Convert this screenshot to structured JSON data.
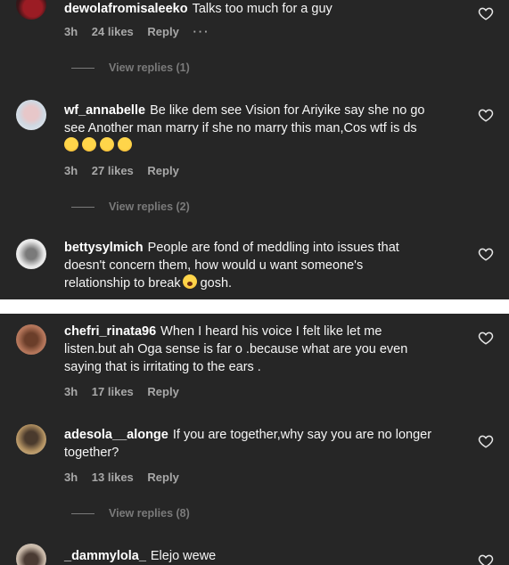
{
  "comments_top": [
    {
      "username": "dewolafromisaleeko",
      "text": "Talks too much for a guy",
      "time": "3h",
      "likes": "24 likes",
      "reply": "Reply",
      "more": "···",
      "view_replies": "View replies (1)"
    },
    {
      "username": "wf_annabelle",
      "text_line1": "Be like dem see Vision for Ariyike say she no go",
      "text_line2": "see Another man marry if she no marry this man,Cos wtf is ds",
      "emojis": [
        "laughing-emoji",
        "laughing-emoji",
        "laughing-emoji",
        "laughing-emoji"
      ],
      "time": "3h",
      "likes": "27 likes",
      "reply": "Reply",
      "view_replies": "View replies (2)"
    },
    {
      "username": "bettysylmich",
      "text_line1": "People are fond of meddling into issues that",
      "text_line2": "doesn't concern them, how would u want someone's",
      "text_line3a": "relationship to break",
      "text_line3b": "gosh."
    }
  ],
  "comments_bottom": [
    {
      "username": "chefri_rinata96",
      "text_line1": "When I heard his voice I felt like let me",
      "text_line2": "listen.but ah Oga sense is far o .because what are you even",
      "text_line3": "saying that is irritating to the ears .",
      "time": "3h",
      "likes": "17 likes",
      "reply": "Reply"
    },
    {
      "username": "adesola__alonge",
      "text_line1": "If you are together,why say you are no longer",
      "text_line2": "together?",
      "time": "3h",
      "likes": "13 likes",
      "reply": "Reply",
      "view_replies": "View replies (8)"
    },
    {
      "username": "_dammylola_",
      "text": "Elejo wewe"
    }
  ],
  "colors": {
    "background": "#262626",
    "text": "#f5f5f5",
    "meta": "#a8a8a8",
    "separator": "#ffffff"
  },
  "icons": {
    "like": "heart-outline-icon"
  }
}
